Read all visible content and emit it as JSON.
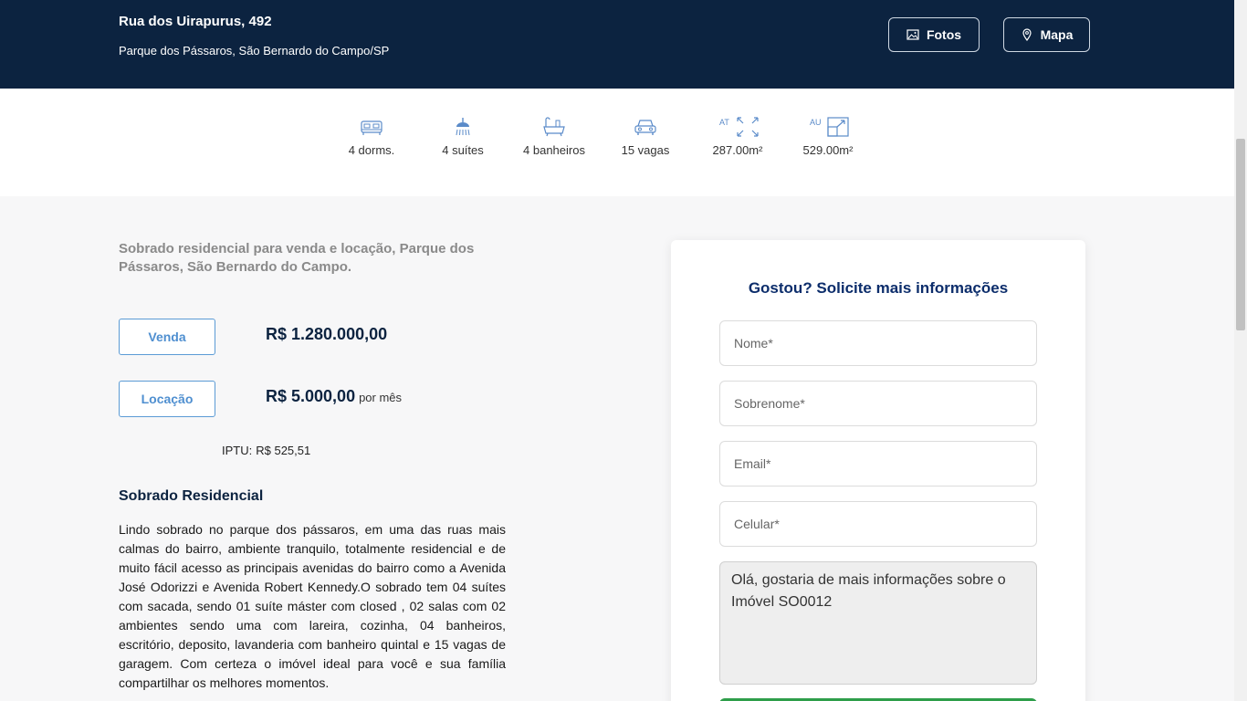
{
  "header": {
    "street": "Rua dos Uirapurus, 492",
    "city": "Parque dos Pássaros, São Bernardo do Campo/SP",
    "fotos_label": "Fotos",
    "mapa_label": "Mapa"
  },
  "features": [
    {
      "icon": "bed-icon",
      "label": "4 dorms."
    },
    {
      "icon": "shower-icon",
      "label": "4 suítes"
    },
    {
      "icon": "bathtub-icon",
      "label": "4 banheiros"
    },
    {
      "icon": "car-icon",
      "label": "15 vagas"
    },
    {
      "icon": "area-total-icon",
      "abbr": "AT",
      "label": "287.00m²"
    },
    {
      "icon": "area-util-icon",
      "abbr": "AU",
      "label": "529.00m²"
    }
  ],
  "listing": {
    "headline": "Sobrado residencial para venda e locação, Parque dos Pássaros, São Bernardo do Campo.",
    "venda_label": "Venda",
    "venda_price": "R$ 1.280.000,00",
    "locacao_label": "Locação",
    "locacao_price": "R$ 5.000,00",
    "per_month": "por mês",
    "iptu_label": "IPTU:",
    "iptu_value": "R$ 525,51",
    "desc_title": "Sobrado Residencial",
    "description": "Lindo sobrado no parque dos pássaros, em uma das ruas mais calmas do bairro, ambiente tranquilo, totalmente residencial e de muito fácil acesso as principais avenidas do bairro como a Avenida José Odorizzi e Avenida Robert Kennedy.O sobrado tem 04 suítes com sacada, sendo 01 suíte máster com closed , 02 salas com 02 ambientes sendo uma com lareira, cozinha, 04 banheiros, escritório, deposito, lavanderia com banheiro quintal e 15 vagas de garagem. Com certeza o imóvel ideal para você e sua família compartilhar os melhores momentos."
  },
  "form": {
    "title": "Gostou? Solicite mais informações",
    "nome_placeholder": "Nome*",
    "sobrenome_placeholder": "Sobrenome*",
    "email_placeholder": "Email*",
    "celular_placeholder": "Celular*",
    "message": "Olá, gostaria de mais informações sobre o Imóvel SO0012"
  },
  "colors": {
    "header_bg": "#0c2340",
    "accent_blue": "#4f8fd0",
    "form_title": "#0c2d6b",
    "submit_green": "#2e9e4a"
  }
}
